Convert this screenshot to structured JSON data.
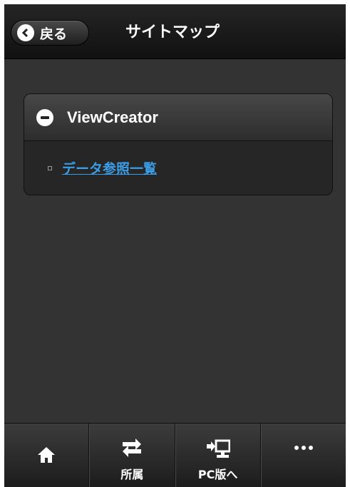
{
  "header": {
    "back_label": "戻る",
    "title": "サイトマップ"
  },
  "sitemap": {
    "section_title": "ViewCreator",
    "link_label": "データ参照一覧"
  },
  "navbar": {
    "items": [
      {
        "label": "",
        "icon": "home-icon"
      },
      {
        "label": "所属",
        "icon": "swap-arrows-icon"
      },
      {
        "label": "PC版へ",
        "icon": "pc-switch-icon"
      },
      {
        "label": "",
        "icon": "more-icon"
      }
    ]
  },
  "colors": {
    "background": "#333333",
    "header": "#1a1a1a",
    "link": "#3a9de6"
  }
}
